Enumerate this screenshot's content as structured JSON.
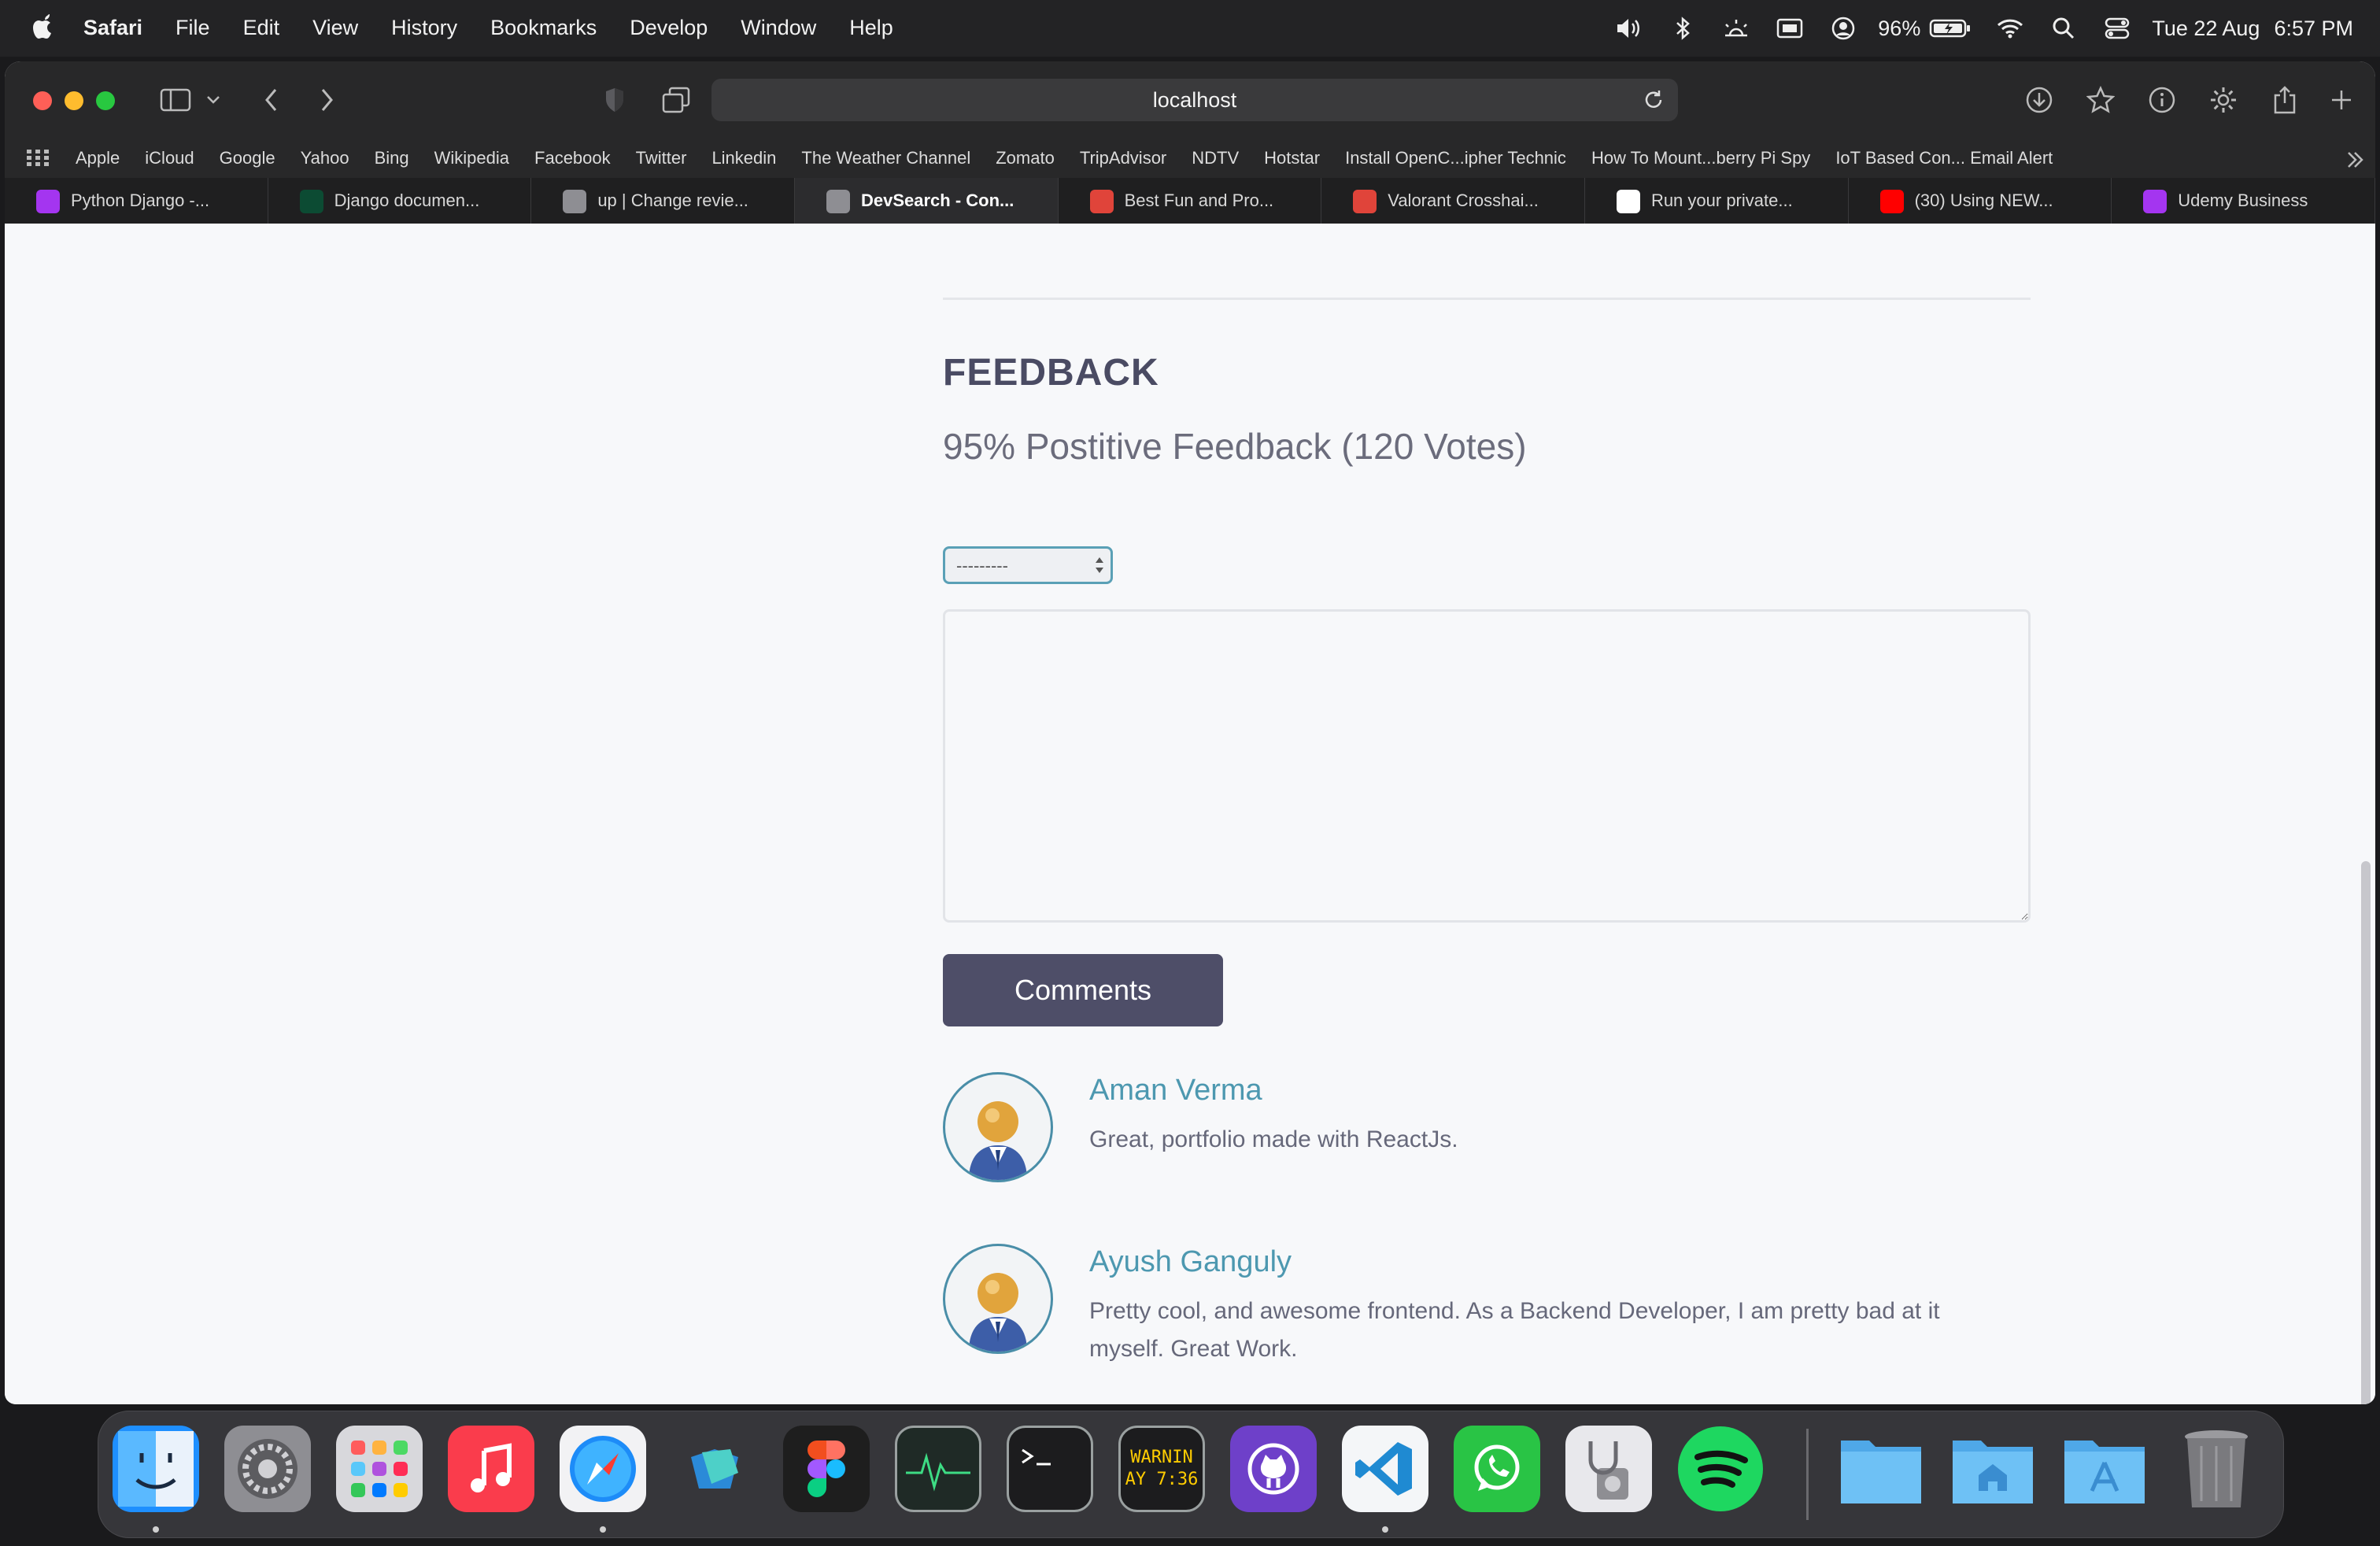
{
  "menubar": {
    "items": [
      "Safari",
      "File",
      "Edit",
      "View",
      "History",
      "Bookmarks",
      "Develop",
      "Window",
      "Help"
    ],
    "battery": "96%",
    "date": "Tue 22 Aug",
    "time": "6:57 PM"
  },
  "browser": {
    "url": "localhost",
    "favorites": [
      "Apple",
      "iCloud",
      "Google",
      "Yahoo",
      "Bing",
      "Wikipedia",
      "Facebook",
      "Twitter",
      "Linkedin",
      "The Weather Channel",
      "Zomato",
      "TripAdvisor",
      "NDTV",
      "Hotstar",
      "Install OpenC...ipher Technic",
      "How To Mount...berry Pi Spy",
      "IoT Based Con... Email Alert"
    ],
    "tabs": [
      {
        "title": "Python Django -...",
        "icon": "udemy-icon",
        "color": "#a435f0"
      },
      {
        "title": "Django documen...",
        "icon": "django-icon",
        "color": "#0c4b33"
      },
      {
        "title": "up | Change revie...",
        "icon": "letter-l-icon",
        "color": "#8e8e93"
      },
      {
        "title": "DevSearch - Con...",
        "icon": "letter-l-icon",
        "color": "#8e8e93",
        "active": true
      },
      {
        "title": "Best Fun and Pro...",
        "icon": "cross-icon",
        "color": "#e0443a"
      },
      {
        "title": "Valorant Crosshai...",
        "icon": "cross-icon",
        "color": "#e0443a"
      },
      {
        "title": "Run your private...",
        "icon": "medium-icon",
        "color": "#ffffff"
      },
      {
        "title": "(30) Using NEW...",
        "icon": "youtube-icon",
        "color": "#ff0000"
      },
      {
        "title": "Udemy Business",
        "icon": "udemy-icon",
        "color": "#a435f0"
      }
    ]
  },
  "page": {
    "heading": "FEEDBACK",
    "ratio_text": "95% Postitive Feedback (120 Votes)",
    "select_value": "---------",
    "submit_label": "Comments",
    "comments": [
      {
        "author": "Aman Verma",
        "text": "Great, portfolio made with ReactJs."
      },
      {
        "author": "Ayush Ganguly",
        "text": "Pretty cool, and awesome frontend. As a Backend Developer, I am pretty bad at it myself. Great Work."
      }
    ]
  },
  "dock": {
    "apps": [
      "finder",
      "system-settings",
      "launchpad",
      "music",
      "safari",
      "freeform",
      "figma",
      "activity-monitor",
      "terminal",
      "console",
      "github-desktop",
      "vscode",
      "whatsapp",
      "disk-utility",
      "spotify"
    ],
    "console_text": [
      "WARNIN",
      "AY 7:36"
    ],
    "folders": [
      "downloads-folder",
      "home-folder",
      "applications-folder",
      "trash"
    ]
  }
}
